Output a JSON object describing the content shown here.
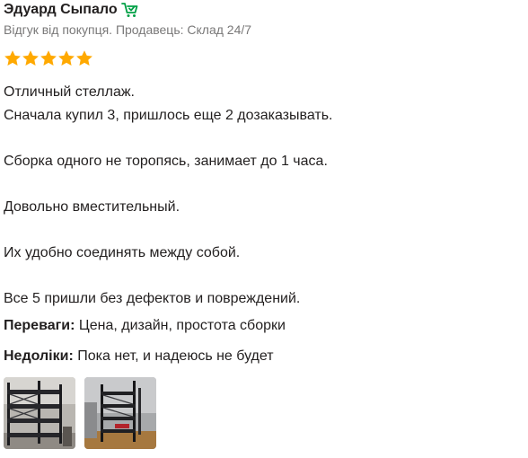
{
  "review": {
    "author": "Эдуард Сыпало",
    "meta": "Відгук від покупця. Продавець: Склад 24/7",
    "rating": 5,
    "rating_max": 5,
    "star_color": "#ffa900",
    "buyer_icon": "shopping-cart-check-icon",
    "buyer_icon_color": "#00a046",
    "text": "Отличный стеллаж.\nСначала купил 3, пришлось еще 2 дозаказывать.\n\nСборка одного не торопясь, занимает до 1 часа.\n\nДовольно вместительный.\n\nИх удобно соединять между собой.\n\nВсе 5 пришли без дефектов и повреждений.",
    "pros_label": "Переваги:",
    "pros_text": "Цена, дизайн, простота сборки",
    "cons_label": "Недоліки:",
    "cons_text": "Пока нет, и надеюсь не будет",
    "photos": [
      {
        "name": "review-photo-1"
      },
      {
        "name": "review-photo-2"
      }
    ]
  }
}
